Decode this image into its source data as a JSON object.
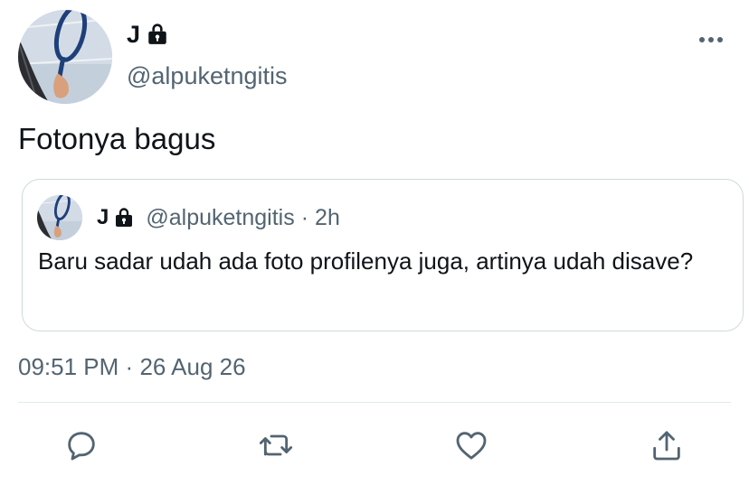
{
  "author": {
    "display_name": "J",
    "handle": "@alpuketngitis",
    "protected_icon": "lock-icon",
    "avatar_icon": "tennis-racket-avatar"
  },
  "tweet": {
    "text": "Fotonya bagus",
    "time": "09:51 PM",
    "date": "26 Aug 26",
    "separator": "·"
  },
  "quoted_tweet": {
    "display_name": "J",
    "handle": "@alpuketngitis",
    "separator": "·",
    "time": "2h",
    "text": "Baru sadar udah ada foto profilenya juga, artinya udah disave?"
  },
  "actions": [
    {
      "icon": "reply-icon"
    },
    {
      "icon": "retweet-icon"
    },
    {
      "icon": "like-icon"
    },
    {
      "icon": "share-icon"
    }
  ],
  "colors": {
    "text_primary": "#0f1419",
    "text_secondary": "#536471",
    "border": "#cfd9de",
    "divider": "#e1e8ed"
  }
}
